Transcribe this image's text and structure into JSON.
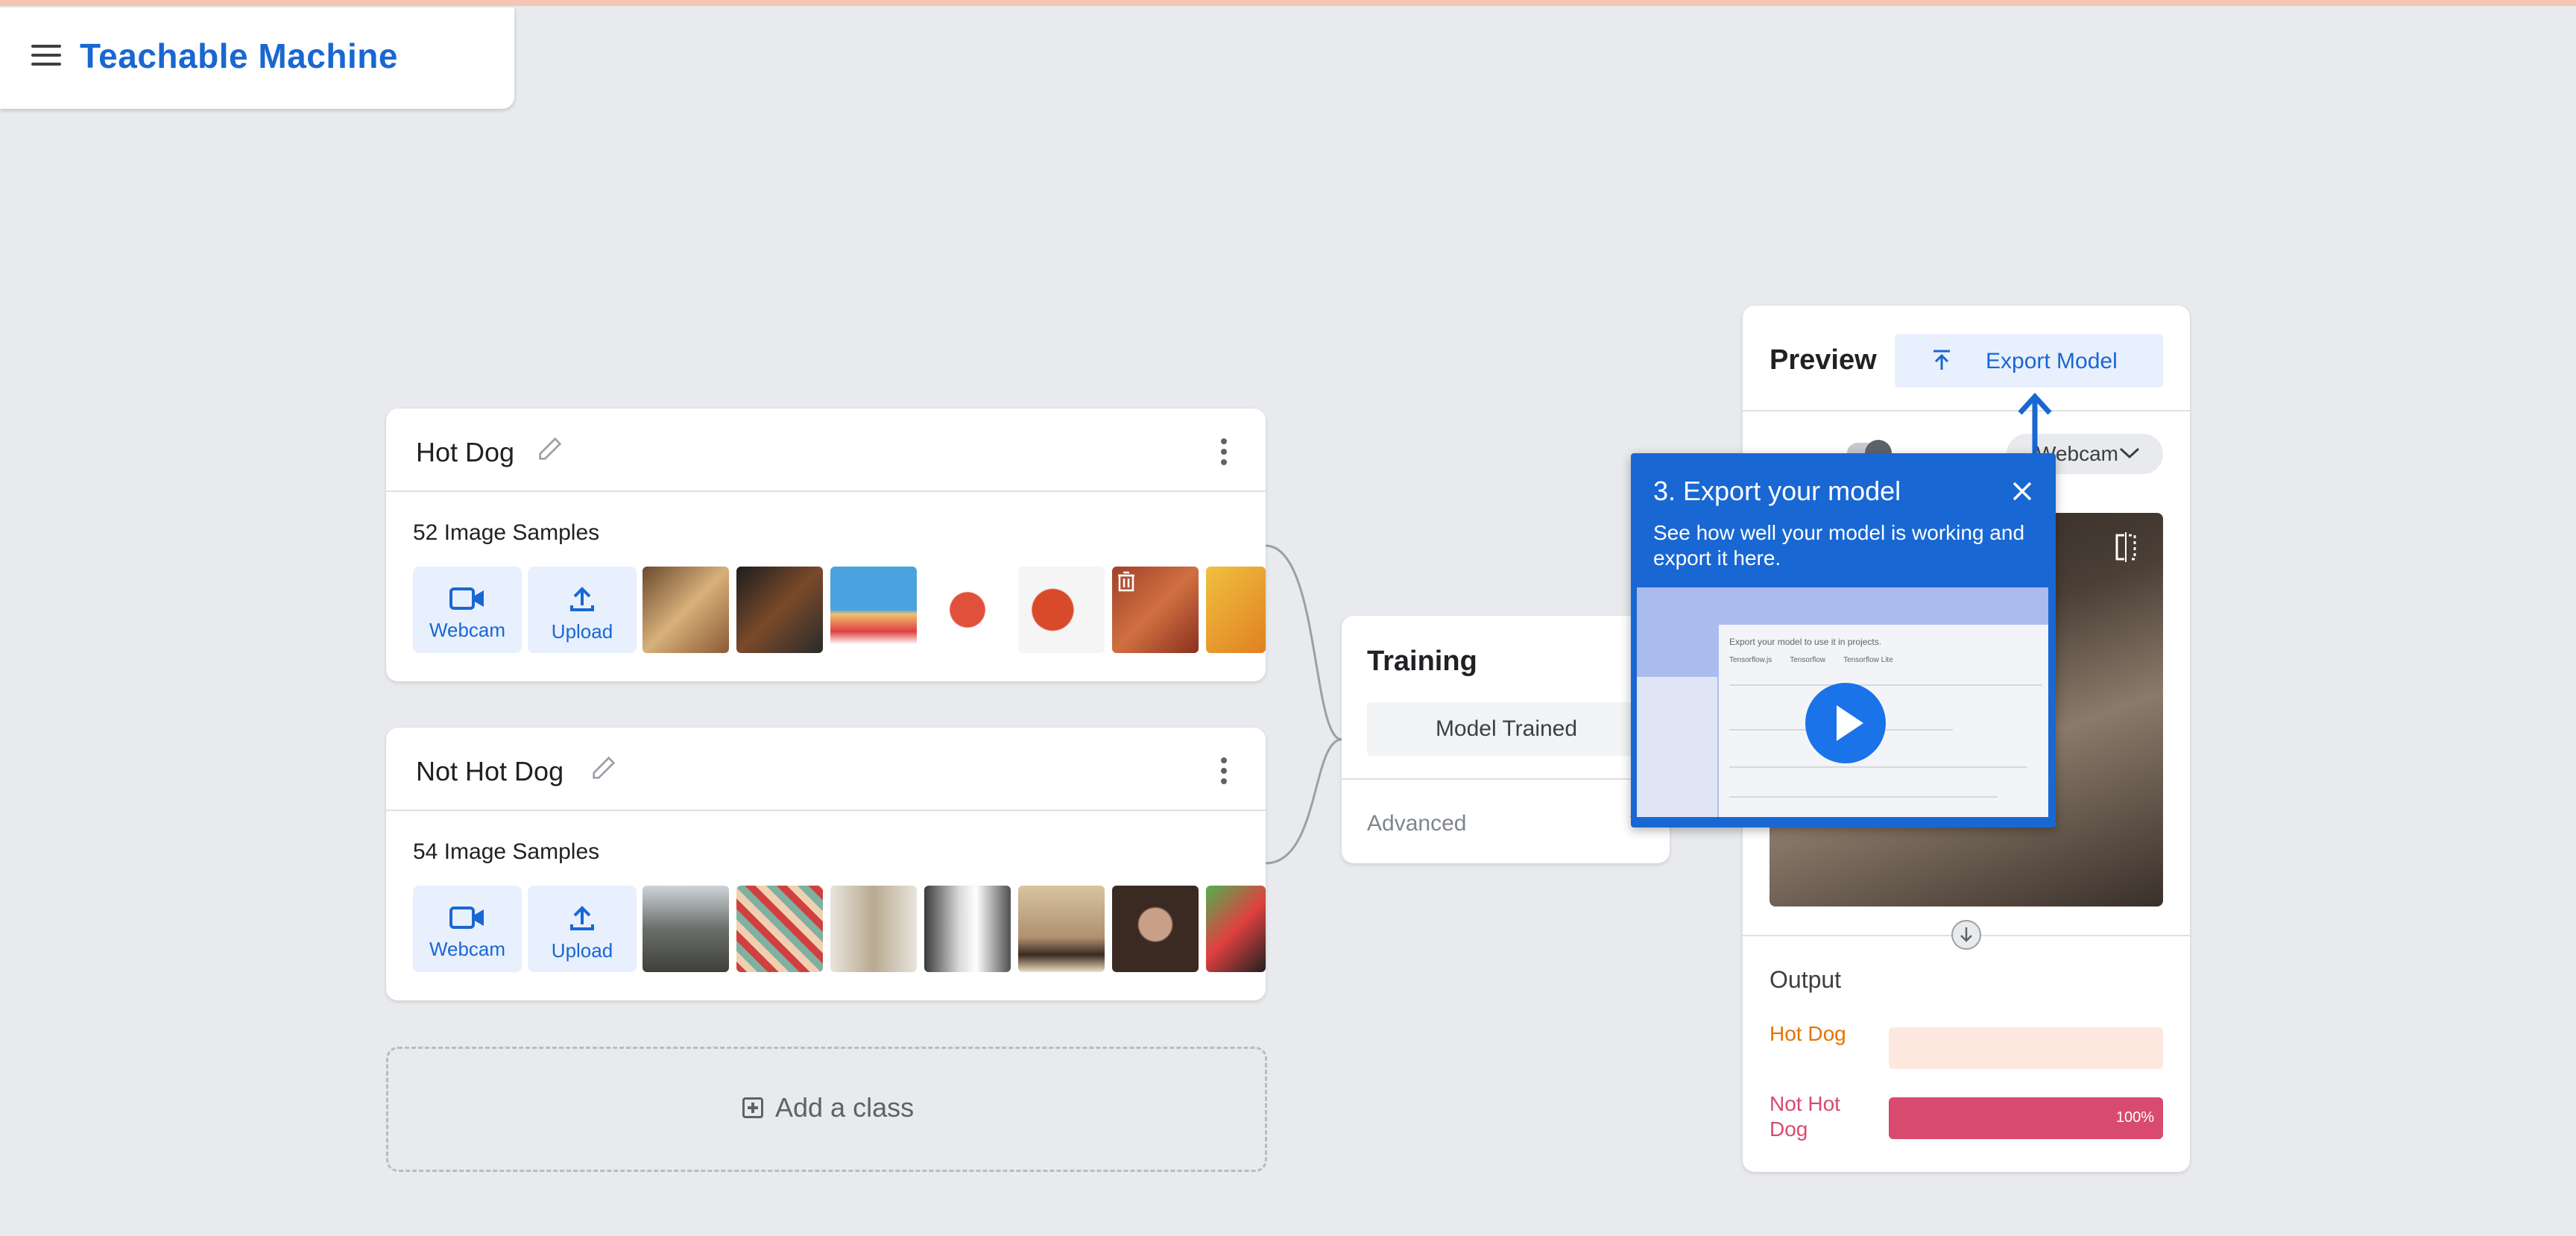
{
  "app": {
    "title": "Teachable Machine"
  },
  "classes": [
    {
      "name": "Hot Dog",
      "samples": "52 Image Samples",
      "webcam_label": "Webcam",
      "upload_label": "Upload"
    },
    {
      "name": "Not Hot Dog",
      "samples": "54 Image Samples",
      "webcam_label": "Webcam",
      "upload_label": "Upload"
    }
  ],
  "add_class": {
    "label": "Add a class"
  },
  "training": {
    "title": "Training",
    "button": "Model Trained",
    "advanced": "Advanced"
  },
  "preview": {
    "title": "Preview",
    "export_label": "Export Model",
    "input_source": "Webcam",
    "output_title": "Output",
    "outputs": [
      {
        "label": "Hot Dog",
        "confidence": 0,
        "color": "#e37400",
        "track": "#fde8df"
      },
      {
        "label": "Not Hot Dog",
        "confidence": 100,
        "pct_text": "100%",
        "color": "#d84a6e",
        "track": "#fce4ec"
      }
    ]
  },
  "tooltip": {
    "title": "3. Export your model",
    "description": "See how well your model is working and export it here.",
    "video": {
      "heading": "Export your model to use it in projects.",
      "tabs": [
        "Tensorflow.js",
        "Tensorflow",
        "Tensorflow Lite"
      ]
    }
  },
  "colors": {
    "brand": "#1967d2",
    "accent_bg": "#e8f0fe",
    "background": "#e8eaed"
  }
}
